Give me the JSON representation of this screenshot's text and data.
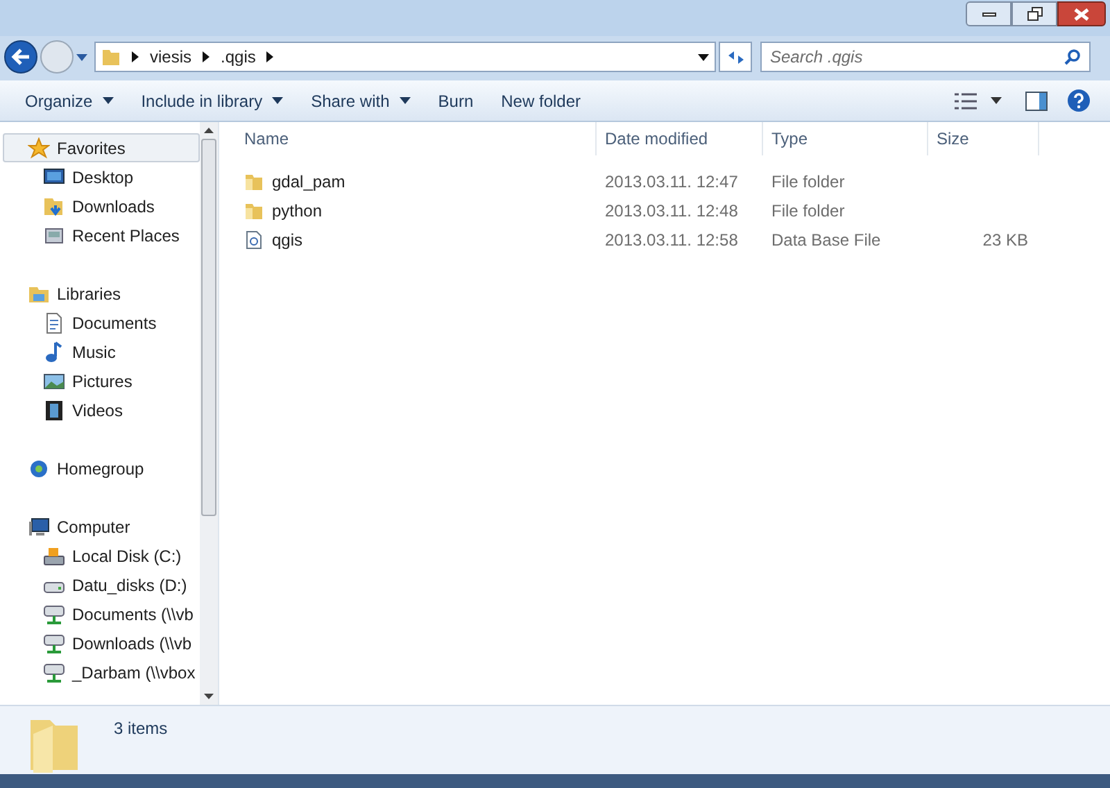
{
  "address": {
    "crumbs": [
      "viesis",
      ".qgis"
    ]
  },
  "search": {
    "placeholder": "Search .qgis"
  },
  "toolbar": {
    "buttons": [
      {
        "label": "Organize",
        "dropdown": true
      },
      {
        "label": "Include in library",
        "dropdown": true
      },
      {
        "label": "Share with",
        "dropdown": true
      },
      {
        "label": "Burn",
        "dropdown": false
      },
      {
        "label": "New folder",
        "dropdown": false
      }
    ]
  },
  "sidebar": {
    "groups": [
      {
        "label": "Favorites",
        "kind": "star",
        "selected": true,
        "items": [
          {
            "label": "Desktop",
            "kind": "desktop"
          },
          {
            "label": "Downloads",
            "kind": "downloads"
          },
          {
            "label": "Recent Places",
            "kind": "recent"
          }
        ]
      },
      {
        "label": "Libraries",
        "kind": "library",
        "selected": false,
        "items": [
          {
            "label": "Documents",
            "kind": "document"
          },
          {
            "label": "Music",
            "kind": "music"
          },
          {
            "label": "Pictures",
            "kind": "picture"
          },
          {
            "label": "Videos",
            "kind": "video"
          }
        ]
      },
      {
        "label": "Homegroup",
        "kind": "homegroup",
        "selected": false
      },
      {
        "label": "Computer",
        "kind": "computer",
        "selected": false,
        "items": [
          {
            "label": "Local Disk (C:)",
            "kind": "sysdisk"
          },
          {
            "label": "Datu_disks (D:)",
            "kind": "disk"
          },
          {
            "label": "Documents (\\\\vb",
            "kind": "netdrive"
          },
          {
            "label": "Downloads (\\\\vb",
            "kind": "netdrive"
          },
          {
            "label": "_Darbam (\\\\vbox",
            "kind": "netdrive"
          }
        ]
      }
    ]
  },
  "table": {
    "columns": [
      "Name",
      "Date modified",
      "Type",
      "Size"
    ],
    "rows": [
      {
        "kind": "folder",
        "name": "gdal_pam",
        "date": "2013.03.11. 12:47",
        "type": "File folder"
      },
      {
        "kind": "folder",
        "name": "python",
        "date": "2013.03.11. 12:48",
        "type": "File folder"
      },
      {
        "kind": "file",
        "name": "qgis",
        "date": "2013.03.11. 12:58",
        "type": "Data Base File",
        "size": "23 KB"
      }
    ]
  },
  "status_bar": {
    "count": "3 items"
  }
}
